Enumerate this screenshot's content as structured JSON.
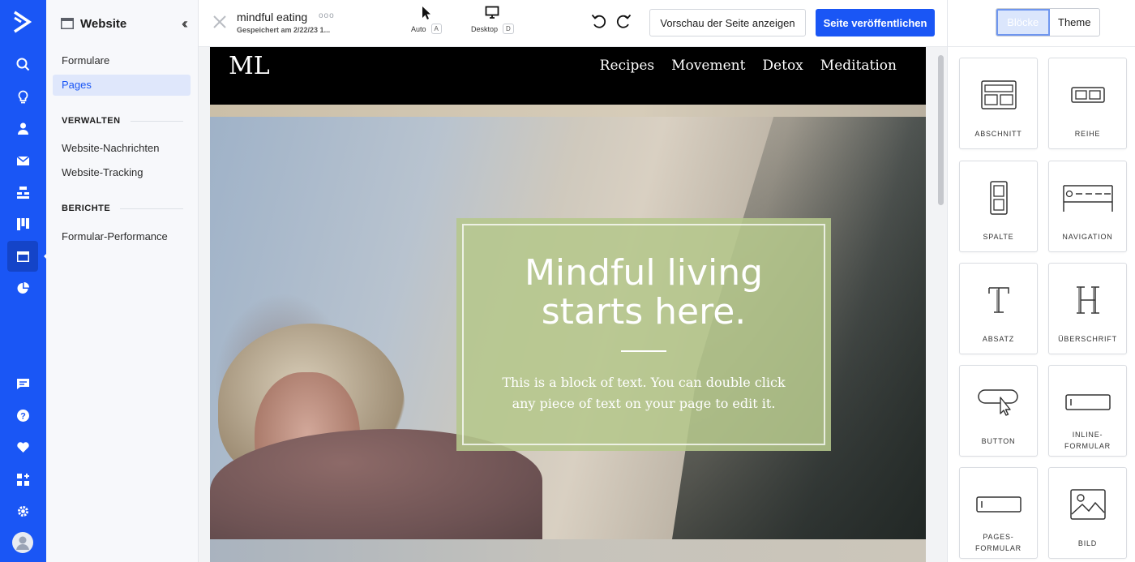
{
  "rail": {
    "items": [
      "search-icon",
      "lightbulb-icon",
      "user-icon",
      "mail-icon",
      "sitemap-icon",
      "kanban-icon",
      "website-icon",
      "pie-chart-icon",
      "chat-icon",
      "help-icon",
      "heart-icon",
      "apps-icon",
      "gear-icon",
      "avatar"
    ]
  },
  "sidebar": {
    "title": "Website",
    "items": [
      {
        "label": "Formulare"
      },
      {
        "label": "Pages"
      }
    ],
    "section_manage": "VERWALTEN",
    "manage_items": [
      {
        "label": "Website-Nachrichten"
      },
      {
        "label": "Website-Tracking"
      }
    ],
    "section_reports": "BERICHTE",
    "report_items": [
      {
        "label": "Formular-Performance"
      }
    ]
  },
  "toolbar": {
    "doc_name": "mindful eating",
    "doc_menu": "ooo",
    "saved": "Gespeichert am 2/22/23 1...",
    "mode_auto": "Auto",
    "mode_auto_key": "A",
    "mode_desktop": "Desktop",
    "mode_desktop_key": "D",
    "preview_label": "Vorschau der Seite anzeigen",
    "publish_label": "Seite veröffentlichen"
  },
  "site": {
    "logo": "ML",
    "menu": [
      "Recipes",
      "Movement",
      "Detox",
      "Meditation"
    ],
    "hero_title_1": "Mindful living",
    "hero_title_2": "starts here.",
    "hero_text": "This is a block of text.  You can double click any piece of text on your page to edit it."
  },
  "panel": {
    "tab_blocks": "Blöcke",
    "tab_theme": "Theme",
    "blocks": [
      {
        "label": "ABSCHNITT",
        "icon": "section-icon"
      },
      {
        "label": "REIHE",
        "icon": "row-icon"
      },
      {
        "label": "SPALTE",
        "icon": "column-icon"
      },
      {
        "label": "NAVIGATION",
        "icon": "navigation-icon"
      },
      {
        "label": "ABSATZ",
        "icon": "paragraph-icon"
      },
      {
        "label": "ÜBERSCHRIFT",
        "icon": "heading-icon"
      },
      {
        "label": "BUTTON",
        "icon": "button-icon"
      },
      {
        "label": "INLINE-FORMULAR",
        "icon": "inline-form-icon"
      },
      {
        "label": "PAGES-FORMULAR",
        "icon": "pages-form-icon"
      },
      {
        "label": "BILD",
        "icon": "image-icon"
      }
    ]
  },
  "colors": {
    "brand": "#1a56f5",
    "hero_card": "#b5c78c"
  }
}
